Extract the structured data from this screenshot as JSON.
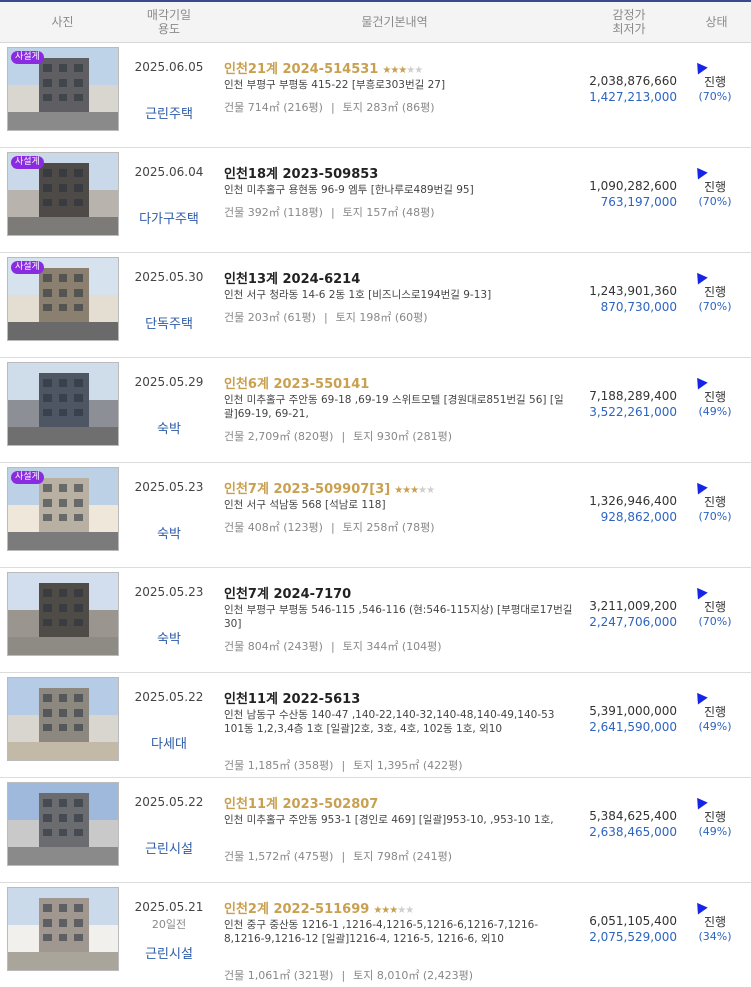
{
  "header": {
    "photo": "사진",
    "date_line1": "매각기일",
    "date_line2": "용도",
    "info": "물건기본내역",
    "price_line1": "감정가",
    "price_line2": "최저가",
    "status": "상태"
  },
  "badge_label": "사설게",
  "listings": [
    {
      "date": "2025.06.05",
      "sub": "",
      "use": "근린주택",
      "title": "인천21계 2024-514531",
      "title_color": "gold",
      "stars": 3,
      "addr": "인천 부평구 부평동 415-22 [부흥로303번길 27]",
      "building": "건물 714㎡ (216평)",
      "land": "토지 283㎡ (86평)",
      "appraised": "2,038,876,660",
      "minimum": "1,427,213,000",
      "status": "진행",
      "ratio": "(70%)",
      "has_badge": true
    },
    {
      "date": "2025.06.04",
      "sub": "",
      "use": "다가구주택",
      "title": "인천18계 2023-509853",
      "title_color": "black",
      "stars": 0,
      "addr": "인천 미추홀구 용현동 96-9 엠투 [한나루로489번길 95]",
      "building": "건물 392㎡ (118평)",
      "land": "토지 157㎡ (48평)",
      "appraised": "1,090,282,600",
      "minimum": "763,197,000",
      "status": "진행",
      "ratio": "(70%)",
      "has_badge": true
    },
    {
      "date": "2025.05.30",
      "sub": "",
      "use": "단독주택",
      "title": "인천13계 2024-6214",
      "title_color": "black",
      "stars": 0,
      "addr": "인천 서구 청라동 14-6 2동 1호 [비즈니스로194번길 9-13]",
      "building": "건물 203㎡ (61평)",
      "land": "토지 198㎡ (60평)",
      "appraised": "1,243,901,360",
      "minimum": "870,730,000",
      "status": "진행",
      "ratio": "(70%)",
      "has_badge": true
    },
    {
      "date": "2025.05.29",
      "sub": "",
      "use": "숙박",
      "title": "인천6계 2023-550141",
      "title_color": "gold",
      "stars": 0,
      "addr": "인천 미추홀구 주안동 69-18 ,69-19 스위트모텔 [경원대로851번길 56] [일괄]69-19, 69-21,",
      "building": "건물 2,709㎡ (820평)",
      "land": "토지 930㎡ (281평)",
      "appraised": "7,188,289,400",
      "minimum": "3,522,261,000",
      "status": "진행",
      "ratio": "(49%)",
      "has_badge": false
    },
    {
      "date": "2025.05.23",
      "sub": "",
      "use": "숙박",
      "title": "인천7계 2023-509907[3]",
      "title_color": "gold",
      "stars": 3,
      "addr": "인천 서구 석남동 568 [석남로 118]",
      "building": "건물 408㎡ (123평)",
      "land": "토지 258㎡ (78평)",
      "appraised": "1,326,946,400",
      "minimum": "928,862,000",
      "status": "진행",
      "ratio": "(70%)",
      "has_badge": true
    },
    {
      "date": "2025.05.23",
      "sub": "",
      "use": "숙박",
      "title": "인천7계 2024-7170",
      "title_color": "black",
      "stars": 0,
      "addr": "인천 부평구 부평동 546-115 ,546-116 (현:546-115지상) [부평대로17번길 30]",
      "building": "건물 804㎡ (243평)",
      "land": "토지 344㎡ (104평)",
      "appraised": "3,211,009,200",
      "minimum": "2,247,706,000",
      "status": "진행",
      "ratio": "(70%)",
      "has_badge": false
    },
    {
      "date": "2025.05.22",
      "sub": "",
      "use": "다세대",
      "title": "인천11계 2022-5613",
      "title_color": "black",
      "stars": 0,
      "addr": "인천 남동구 수산동 140-47 ,140-22,140-32,140-48,140-49,140-53 101동 1,2,3,4층 1호 [일괄]2호, 3호, 4호, 102동 1호, 외10",
      "building": "건물 1,185㎡ (358평)",
      "land": "토지 1,395㎡ (422평)",
      "appraised": "5,391,000,000",
      "minimum": "2,641,590,000",
      "status": "진행",
      "ratio": "(49%)",
      "has_badge": false
    },
    {
      "date": "2025.05.22",
      "sub": "",
      "use": "근린시설",
      "title": "인천11계 2023-502807",
      "title_color": "gold",
      "stars": 0,
      "addr": "인천 미추홀구 주안동 953-1 [경인로 469] [일괄]953-10, ,953-10 1호,",
      "building": "건물 1,572㎡ (475평)",
      "land": "토지 798㎡ (241평)",
      "appraised": "5,384,625,400",
      "minimum": "2,638,465,000",
      "status": "진행",
      "ratio": "(49%)",
      "has_badge": false
    },
    {
      "date": "2025.05.21",
      "sub": "20일전",
      "use": "근린시설",
      "title": "인천2계 2022-511699",
      "title_color": "gold",
      "stars": 3,
      "addr": "인천 중구 중산동 1216-1 ,1216-4,1216-5,1216-6,1216-7,1216-8,1216-9,1216-12 [일괄]1216-4, 1216-5, 1216-6, 외10",
      "building": "건물 1,061㎡ (321평)",
      "land": "토지 8,010㎡ (2,423평)",
      "appraised": "6,051,105,400",
      "minimum": "2,075,529,000",
      "status": "진행",
      "ratio": "(34%)",
      "has_badge": false
    }
  ]
}
